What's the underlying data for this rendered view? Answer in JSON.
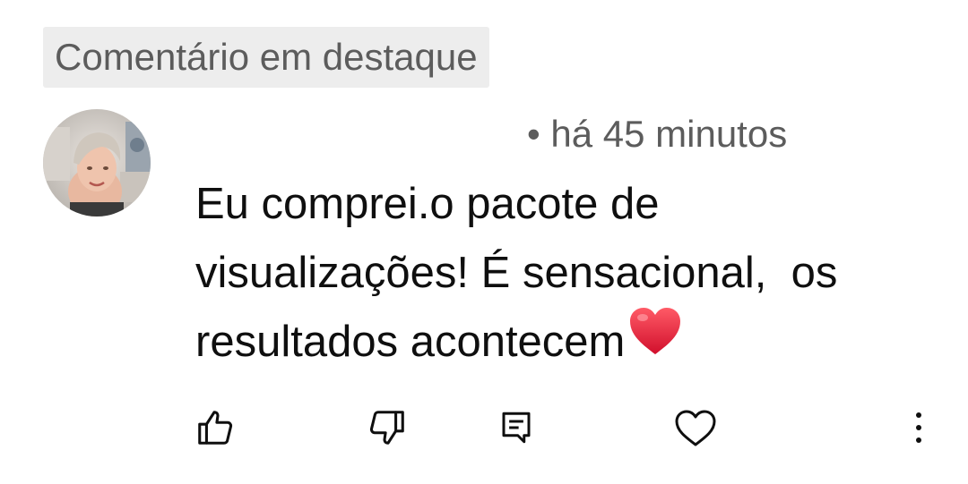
{
  "badge": {
    "label": "Comentário em destaque"
  },
  "comment": {
    "author_avatar": "avatar",
    "timestamp": "• há 45 minutos",
    "text": "Eu comprei.o pacote de visualizações! É sensacional,  os resultados acontecem",
    "emoji": "red-heart"
  },
  "actions": [
    {
      "name": "like",
      "icon": "thumbs-up-icon"
    },
    {
      "name": "dislike",
      "icon": "thumbs-down-icon"
    },
    {
      "name": "reply",
      "icon": "comment-icon"
    },
    {
      "name": "heart",
      "icon": "heart-outline-icon"
    },
    {
      "name": "more",
      "icon": "more-vertical-icon"
    }
  ],
  "colors": {
    "badge_bg": "#ededed",
    "secondary_text": "#5c5c5c",
    "primary_text": "#0f0f0f",
    "heart_red": "#e3203a"
  }
}
